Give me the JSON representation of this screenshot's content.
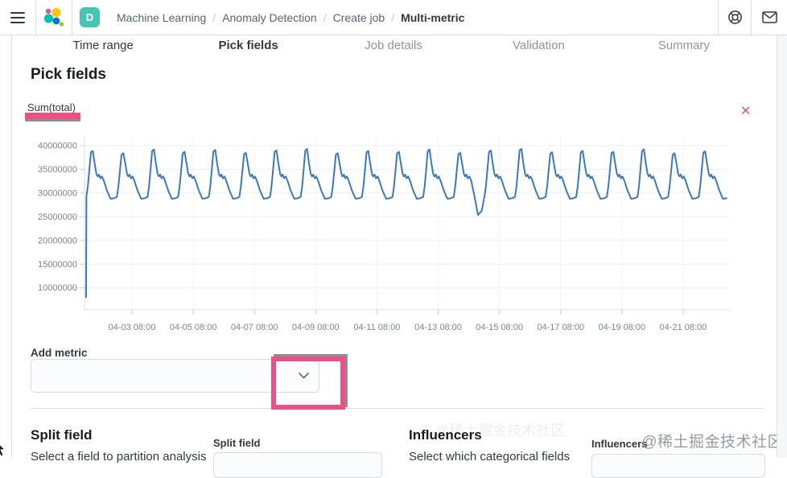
{
  "navbar": {
    "space_badge": "D",
    "breadcrumbs": [
      {
        "label": "Machine Learning",
        "current": false
      },
      {
        "label": "Anomaly Detection",
        "current": false
      },
      {
        "label": "Create job",
        "current": false
      },
      {
        "label": "Multi-metric",
        "current": true
      }
    ]
  },
  "steps": [
    {
      "label": "Time range",
      "state": "complete"
    },
    {
      "label": "Pick fields",
      "state": "current"
    },
    {
      "label": "Job details",
      "state": "incomplete"
    },
    {
      "label": "Validation",
      "state": "incomplete"
    },
    {
      "label": "Summary",
      "state": "incomplete"
    }
  ],
  "page_title": "Pick fields",
  "chart_data": {
    "type": "line",
    "title": "Sum(total)",
    "y_ticks": [
      10000000,
      15000000,
      20000000,
      25000000,
      30000000,
      35000000,
      40000000
    ],
    "x_tick_labels": [
      "04-03 08:00",
      "04-05 08:00",
      "04-07 08:00",
      "04-09 08:00",
      "04-11 08:00",
      "04-13 08:00",
      "04-15 08:00",
      "04-17 08:00",
      "04-19 08:00",
      "04-21 08:00"
    ],
    "x_tick_first_day": 1.55,
    "x_tick_spacing_days": 2,
    "x_domain_days": 21.05,
    "grid": true,
    "legend": "none",
    "series": [
      {
        "name": "Sum(total)",
        "color": "#3b79b8",
        "values_unit": "millions",
        "intro_points": [
          [
            0.05,
            8.0
          ],
          [
            0.062,
            29.0
          ]
        ],
        "cycle_start_day": 0.06,
        "cycle_count": 21,
        "daily_pattern": [
          [
            0.0,
            29.2
          ],
          [
            0.05,
            31.5
          ],
          [
            0.15,
            38.4
          ],
          [
            0.21,
            38.7
          ],
          [
            0.27,
            36.3
          ],
          [
            0.33,
            34.0
          ],
          [
            0.37,
            33.5
          ],
          [
            0.41,
            33.9
          ],
          [
            0.46,
            33.1
          ],
          [
            0.51,
            33.5
          ],
          [
            0.57,
            32.6
          ],
          [
            0.67,
            30.6
          ],
          [
            0.79,
            28.8
          ],
          [
            0.91,
            28.9
          ]
        ],
        "peak_jitter": [
          0.2,
          -0.3,
          0.5,
          0.0,
          0.4,
          -0.2,
          0.3,
          0.6,
          -0.3,
          0.2,
          0.0,
          0.5,
          -0.2,
          0.3,
          0.6,
          -0.1,
          0.2,
          0.0,
          0.5,
          -0.3,
          0.1
        ],
        "anomaly": {
          "cycle_index": 12,
          "overrides": [
            [
              0.67,
              29.5
            ],
            [
              0.79,
              25.4
            ],
            [
              0.91,
              26.2
            ]
          ]
        }
      }
    ]
  },
  "icons": {
    "close": "✕",
    "breadcrumb_separator": "/"
  },
  "add_metric": {
    "label": "Add metric"
  },
  "split_field": {
    "heading": "Split field",
    "description": "Select a field to partition analysis",
    "label": "Split field"
  },
  "influencers": {
    "heading": "Influencers",
    "description": "Select which categorical fields",
    "label": "Influencers"
  },
  "watermark": "@稀土掘金技术社区",
  "colors": {
    "annotation_pink": "#ee4f86",
    "line_blue": "#3b79b8",
    "space_badge_teal": "#45c5b3",
    "close_red": "#e0565f",
    "border": "#d3dae6"
  }
}
